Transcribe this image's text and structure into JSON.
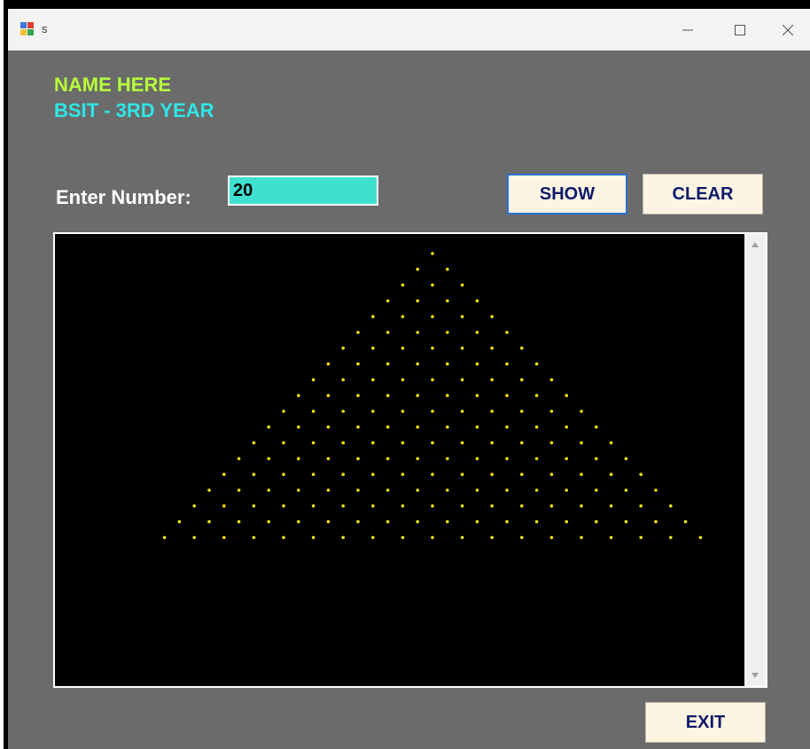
{
  "window": {
    "title": "s"
  },
  "header": {
    "name": "NAME HERE",
    "course": "BSIT - 3RD YEAR"
  },
  "form": {
    "enter_label": "Enter Number:",
    "number_value": "20"
  },
  "buttons": {
    "show": "SHOW",
    "clear": "CLEAR",
    "exit": "EXIT"
  },
  "output": {
    "rows": 19,
    "dot_color": "#f5e000",
    "background": "#000000"
  },
  "colors": {
    "name": "#b6ff3a",
    "course": "#2ee6e6",
    "panel_bg": "#6b6b6b",
    "input_bg": "#40e0d0",
    "button_text": "#0d1a6b"
  },
  "icons": {
    "app": "app-icon",
    "minimize": "minimize-icon",
    "maximize": "maximize-icon",
    "close": "close-icon",
    "scroll_up": "scroll-up-arrow-icon",
    "scroll_down": "scroll-down-arrow-icon"
  }
}
